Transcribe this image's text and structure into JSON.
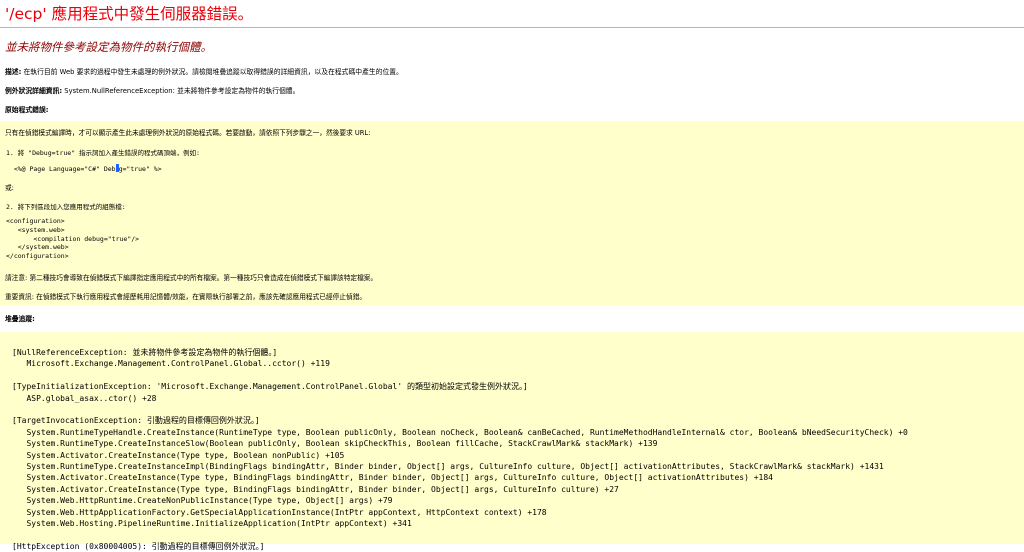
{
  "page_title": "'/ecp' 應用程式中發生伺服器錯誤。",
  "error_heading": "並未將物件參考設定為物件的執行個體。",
  "description": {
    "label": "描述:",
    "text": " 在執行目前 Web 要求的過程中發生未處理的例外狀況。請檢閱堆疊追蹤以取得錯誤的詳細資訊，以及在程式碼中產生的位置。"
  },
  "exception_details": {
    "label": "例外狀況詳細資訊:",
    "text": " System.NullReferenceException: 並未將物件參考設定為物件的執行個體。"
  },
  "source_error_label": "原始程式錯誤:",
  "source_box": {
    "intro": "只有在偵錯模式編譯時，才可以顯示產生此未處理例外狀況的原始程式碼。若要啟動，請依照下列步驟之一，然後要求 URL:",
    "step1": "1. 將 \"Debug=true\" 指示詞加入產生錯誤的程式碼頂端，例如:",
    "page_directive_a": "  <%@ Page Language=\"C#\" Deb",
    "page_directive_b": "g=\"true\" %>",
    "or": "或:",
    "step2": "2. 將下列區段加入您應用程式的組態檔:",
    "config_lines": [
      "<configuration>",
      "   <system.web>",
      "       <compilation debug=\"true\"/>",
      "   </system.web>",
      "</configuration>"
    ],
    "note": "請注意: 第二種技巧會導致在偵錯模式下編譯指定應用程式中的所有檔案。第一種技巧只會造成在偵錯模式下編譯該特定檔案。",
    "important": "重要資訊: 在偵錯模式下執行應用程式會經歷耗用記憶體/效能，在實際執行部署之前，應該先確認應用程式已經停止偵錯。"
  },
  "stack_trace_label": "堆疊追蹤:",
  "stack_lines": [
    "[NullReferenceException: 並未將物件參考設定為物件的執行個體。]",
    "   Microsoft.Exchange.Management.ControlPanel.Global..cctor() +119",
    "",
    "[TypeInitializationException: 'Microsoft.Exchange.Management.ControlPanel.Global' 的類型初始設定式發生例外狀況。]",
    "   ASP.global_asax..ctor() +28",
    "",
    "[TargetInvocationException: 引動過程的目標傳回例外狀況。]",
    "   System.RuntimeTypeHandle.CreateInstance(RuntimeType type, Boolean publicOnly, Boolean noCheck, Boolean& canBeCached, RuntimeMethodHandleInternal& ctor, Boolean& bNeedSecurityCheck) +0",
    "   System.RuntimeType.CreateInstanceSlow(Boolean publicOnly, Boolean skipCheckThis, Boolean fillCache, StackCrawlMark& stackMark) +139",
    "   System.Activator.CreateInstance(Type type, Boolean nonPublic) +105",
    "   System.RuntimeType.CreateInstanceImpl(BindingFlags bindingAttr, Binder binder, Object[] args, CultureInfo culture, Object[] activationAttributes, StackCrawlMark& stackMark) +1431",
    "   System.Activator.CreateInstance(Type type, BindingFlags bindingAttr, Binder binder, Object[] args, CultureInfo culture, Object[] activationAttributes) +184",
    "   System.Activator.CreateInstance(Type type, BindingFlags bindingAttr, Binder binder, Object[] args, CultureInfo culture) +27",
    "   System.Web.HttpRuntime.CreateNonPublicInstance(Type type, Object[] args) +79",
    "   System.Web.HttpApplicationFactory.GetSpecialApplicationInstance(IntPtr appContext, HttpContext context) +178",
    "   System.Web.Hosting.PipelineRuntime.InitializeApplication(IntPtr appContext) +341",
    "",
    "[HttpException (0x80004005): 引動過程的目標傳回例外狀況。]"
  ],
  "colors": {
    "title": "#e8000b",
    "heading": "#8b0000",
    "code_background": "#ffffcc",
    "rule": "#b5b5b5"
  }
}
